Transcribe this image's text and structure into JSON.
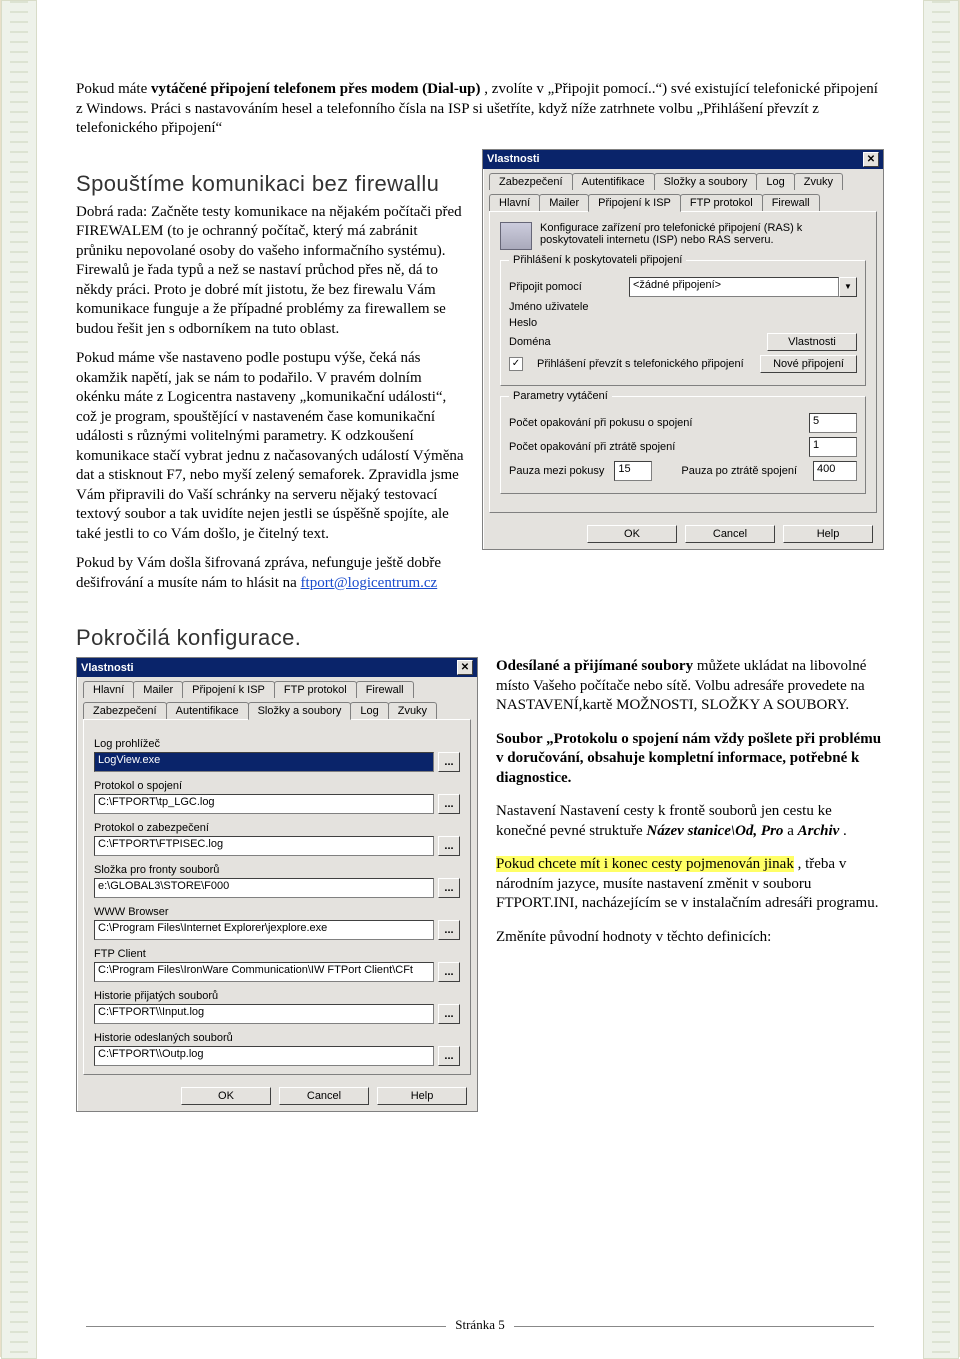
{
  "intro": {
    "p1_prefix": "Pokud máte ",
    "p1_bold": "vytáčené připojení telefonem přes modem (Dial-up)",
    "p1_suffix": ", zvolíte v „Připojit pomocí..“) své existující telefonické připojení z Windows. Práci s nastavováním hesel a telefonního čísla na ISP si ušetříte, když níže zatrhnete volbu „Přihlášení převzít z telefonického připojení“"
  },
  "sec1_title": "Spouštíme komunikaci bez firewallu",
  "sec1_p1": "Dobrá rada: Začněte testy komunikace na nějakém počítači před FIREWALEM (to je ochranný počítač, který má zabránit průniku nepovolané osoby do vašeho informačního systému). Firewalů je řada typů a než se nastaví průchod přes ně, dá to někdy práci. Proto je dobré mít jistotu, že bez firewalu Vám komunikace funguje a že případné problémy za firewallem se budou řešit jen s odborníkem na tuto oblast.",
  "sec1_p2": "Pokud máme vše nastaveno podle postupu výše, čeká nás okamžik napětí, jak se nám to podařilo. V pravém dolním okénku máte z Logicentra nastaveny „komunikační události“, což je program, spouštějící v nastaveném čase komunikační události s různými volitelnými parametry. K odzkoušení komunikace stačí vybrat jednu z načasovaných událostí Výměna dat a stisknout F7, nebo myší zelený semaforek. Zpravidla jsme Vám připravili do Vaší schránky na serveru nějaký testovací textový soubor a  tak uvidíte nejen jestli se úspěšně spojíte, ale také jestli to co Vám došlo, je čitelný text.",
  "sec1_p3a": "Pokud by Vám došla šifrovaná zpráva, nefunguje ještě dobře dešifrování a musíte nám to hlásit na ",
  "sec1_mail": "ftport@logicentrum.cz",
  "dlg1": {
    "title": "Vlastnosti",
    "tabs_row1": [
      "Zabezpečení",
      "Autentifikace",
      "Složky a soubory",
      "Log",
      "Zvuky"
    ],
    "tabs_row2": [
      "Hlavní",
      "Mailer",
      "Připojení k ISP",
      "FTP protokol",
      "Firewall"
    ],
    "active_tab": "Připojení k ISP",
    "note": "Konfigurace zařízení pro telefonické připojení (RAS) k poskytovateli internetu (ISP) nebo RAS serveru.",
    "grp1_legend": "Přihlášení k poskytovateli připojení",
    "lbl_connect": "Připojit pomocí",
    "combo_val": "<žádné připojení>",
    "lbl_user": "Jméno uživatele",
    "lbl_pass": "Heslo",
    "lbl_domain": "Doména",
    "btn_props": "Vlastnosti",
    "chk_label": "Přihlášení převzít s telefonického připojení",
    "btn_newconn": "Nové připojení",
    "grp2_legend": "Parametry vytáčení",
    "lbl_retry_conn": "Počet opakování při pokusu o spojení",
    "val_retry_conn": "5",
    "lbl_retry_lost": "Počet opakování při ztrátě spojení",
    "val_retry_lost": "1",
    "lbl_pause_try": "Pauza mezi pokusy",
    "val_pause_try": "15",
    "lbl_pause_lost": "Pauza po ztrátě spojení",
    "val_pause_lost": "400",
    "ok": "OK",
    "cancel": "Cancel",
    "help": "Help"
  },
  "sec2_title": "Pokročilá konfigurace.",
  "dlg2": {
    "title": "Vlastnosti",
    "tabs_row1": [
      "Hlavní",
      "Mailer",
      "Připojení k ISP",
      "FTP protokol",
      "Firewall"
    ],
    "tabs_row2": [
      "Zabezpečení",
      "Autentifikace",
      "Složky a soubory",
      "Log",
      "Zvuky"
    ],
    "active_tab": "Složky a soubory",
    "fields": [
      {
        "label": "Log prohlížeč",
        "value": "LogView.exe",
        "hilite": true
      },
      {
        "label": "Protokol o spojení",
        "value": "C:\\FTPORT\\tp_LGC.log"
      },
      {
        "label": "Protokol o zabezpečení",
        "value": "C:\\FTPORT\\FTPISEC.log"
      },
      {
        "label": "Složka pro fronty souborů",
        "value": "e:\\GLOBAL3\\STORE\\F000"
      },
      {
        "label": "WWW Browser",
        "value": "C:\\Program Files\\Internet Explorer\\jexplore.exe"
      },
      {
        "label": "FTP Client",
        "value": "C:\\Program Files\\IronWare Communication\\IW FTPort Client\\CFt"
      },
      {
        "label": "Historie přijatých souborů",
        "value": "C:\\FTPORT\\\\Input.log"
      },
      {
        "label": "Historie odeslaných souborů",
        "value": "C:\\FTPORT\\\\Outp.log"
      }
    ],
    "ok": "OK",
    "cancel": "Cancel",
    "help": "Help"
  },
  "right_text": {
    "p1_bold": "Odesílané a přijímané soubory",
    "p1_rest": " můžete ukládat na libovolné místo Vašeho počítače nebo sítě. Volbu adresáře provedete na NASTAVENÍ,kartě MOŽNOSTI, SLOŽKY A SOUBORY.",
    "p2_bold": "Soubor „Protokolu o spojení nám vždy pošlete při problému v doručování, obsahuje kompletní informace, potřebné k diagnostice.",
    "p3_a": "Nastavení Nastavení cesty k frontě souborů jen cestu ke konečné pevné struktuře ",
    "p3_it": "Název stanice\\Od, Pro",
    "p3_b": " a ",
    "p3_it2": "Archiv",
    "p3_c": ".",
    "p4_hl": "Pokud chcete mít i konec cesty pojmenován jinak",
    "p4_rest": ", třeba v národním jazyce, musíte nastavení změnit v souboru FTPORT.INI, nacházejícím se v instalačním adresáři programu.",
    "p5": "Změníte původní hodnoty v těchto definicích:"
  },
  "footer": "Stránka 5"
}
